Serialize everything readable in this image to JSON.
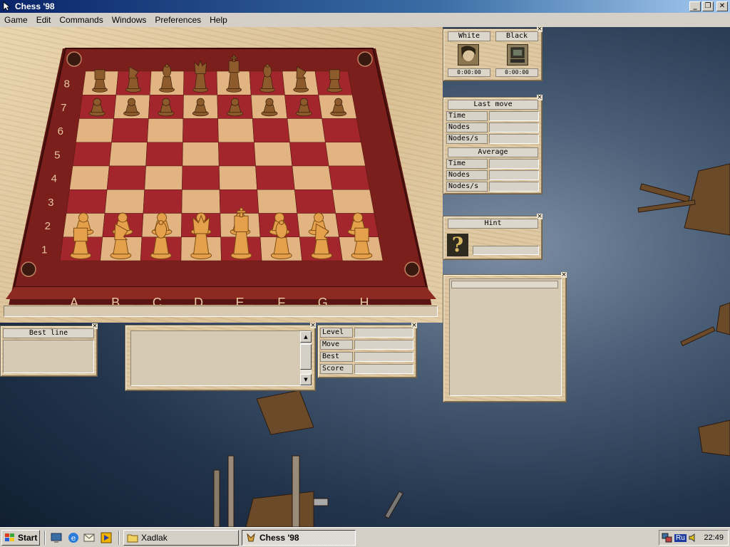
{
  "window": {
    "title": "Chess '98",
    "controls": {
      "minimize": "_",
      "restore": "❐",
      "close": "✕"
    }
  },
  "menu": [
    "Game",
    "Edit",
    "Commands",
    "Windows",
    "Preferences",
    "Help"
  ],
  "board": {
    "files": [
      "A",
      "B",
      "C",
      "D",
      "E",
      "F",
      "G",
      "H"
    ],
    "ranks": [
      "1",
      "2",
      "3",
      "4",
      "5",
      "6",
      "7",
      "8"
    ],
    "colors": {
      "dark_square": "#a3262c",
      "light_square": "#e2b482",
      "frame": "#7a1f1c",
      "white_pieces": "#e5a04c",
      "black_pieces": "#8c5a2b"
    },
    "back_rank_black": [
      "rook",
      "knight",
      "bishop",
      "queen",
      "king",
      "bishop",
      "knight",
      "rook"
    ],
    "back_rank_white": [
      "rook",
      "knight",
      "bishop",
      "queen",
      "king",
      "bishop",
      "knight",
      "rook"
    ]
  },
  "players": {
    "white_label": "White",
    "black_label": "Black",
    "white_clock": "0:00:00",
    "black_clock": "0:00:00"
  },
  "last_move": {
    "header": "Last move",
    "rows": [
      "Time",
      "Nodes",
      "Nodes/s"
    ]
  },
  "average": {
    "header": "Average",
    "rows": [
      "Time",
      "Nodes",
      "Nodes/s"
    ]
  },
  "hint": {
    "header": "Hint",
    "icon_glyph": "?"
  },
  "best_line": {
    "header": "Best line"
  },
  "search_info": {
    "rows": [
      "Level",
      "Move",
      "Best",
      "Score"
    ]
  },
  "taskbar": {
    "start_label": "Start",
    "tasks": [
      "Xadlak",
      "Chess '98"
    ],
    "tray_lang": "Ru",
    "clock": "22:49"
  }
}
